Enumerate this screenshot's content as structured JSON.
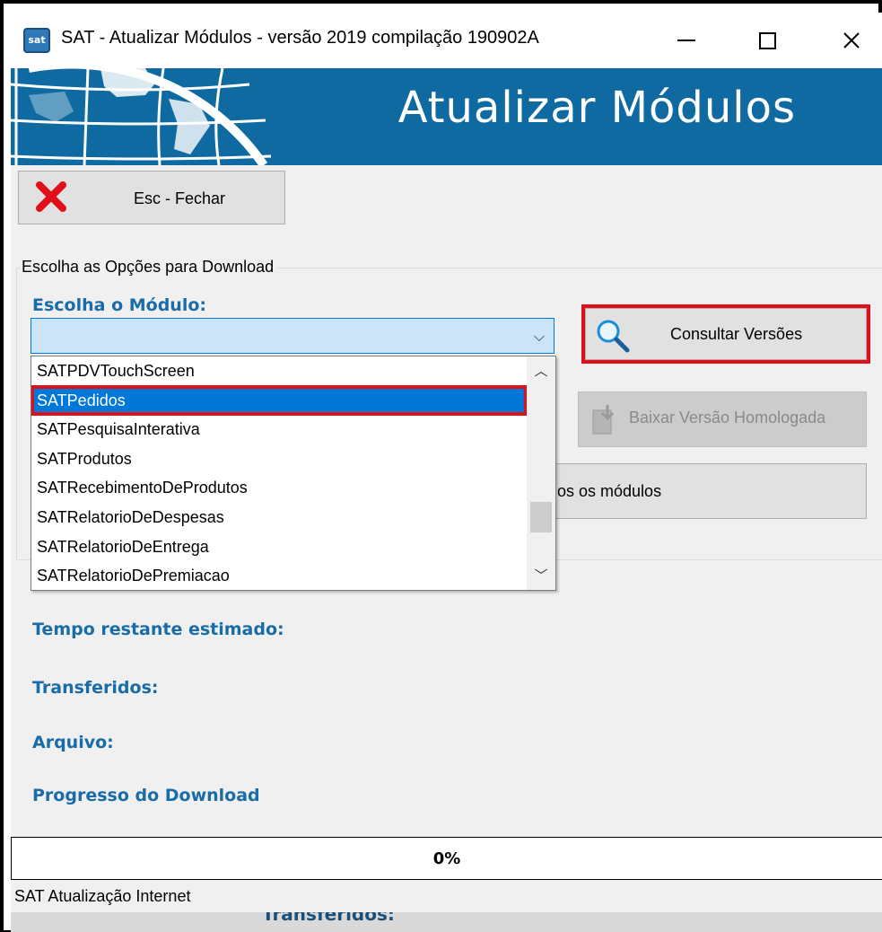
{
  "window": {
    "title": "SAT - Atualizar Módulos - versão 2019 compilação 190902A",
    "icon": "sat-app-icon",
    "controls": {
      "minimize": "minimize-icon",
      "maximize": "maximize-icon",
      "close": "close-icon",
      "close_glyph": "✕"
    }
  },
  "banner": {
    "title": "Atualizar Módulos",
    "color": "#0f6aa1"
  },
  "toolbar": {
    "close_label": "Esc - Fechar",
    "close_icon": "red-x-icon",
    "icon_color": "#e0101a"
  },
  "options": {
    "group_title": "Escolha as Opções para Download",
    "module_label": "Escolha o Módulo:",
    "module_value": "",
    "consult_label": "Consultar Versões",
    "download_label": "Baixar Versão Homologada",
    "all_modules_label": "dos os módulos"
  },
  "module_list": {
    "items": [
      "SATPDVTouchScreen",
      "SATPedidos",
      "SATPesquisaInterativa",
      "SATProdutos",
      "SATRecebimentoDeProdutos",
      "SATRelatorioDeDespesas",
      "SATRelatorioDeEntrega",
      "SATRelatorioDePremiacao"
    ],
    "selected_index": 1,
    "selected_color": "#0078d7",
    "highlight_color": "#e0101a"
  },
  "status": {
    "remaining_label": "Tempo restante estimado:",
    "transferred_label": "Transferidos:",
    "file_label": "Arquivo:",
    "progress_label": "Progresso do Download"
  },
  "progress": {
    "value": 0,
    "text": "0%"
  },
  "statusbar": {
    "text": "SAT Atualização Internet",
    "ghost_text": "Transferidos:"
  }
}
